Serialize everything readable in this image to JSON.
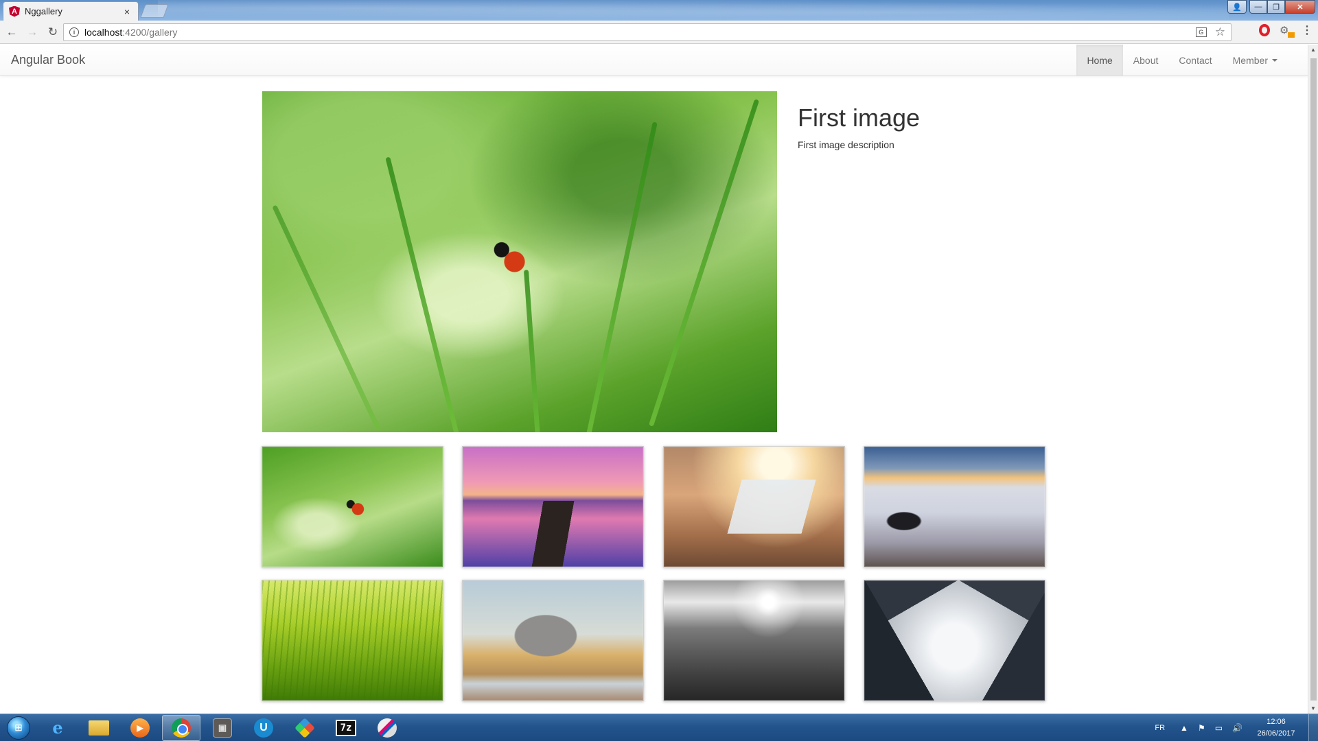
{
  "browser": {
    "tab_title": "Nggallery",
    "tab_close": "×",
    "favicon_letter": "A",
    "url_host": "localhost",
    "url_path": ":4200/gallery",
    "info_glyph": "i",
    "back_glyph": "←",
    "forward_glyph": "→",
    "reload_glyph": "↻",
    "star_glyph": "☆",
    "menu_glyph": "⋮",
    "translate_glyph": "G",
    "icons": [
      "angular-favicon-icon",
      "back-icon",
      "forward-icon",
      "reload-icon",
      "info-icon",
      "translate-icon",
      "star-icon",
      "opera-icon",
      "extension-icon",
      "menu-icon"
    ]
  },
  "window_controls": {
    "minimize": "—",
    "maximize": "❐",
    "close": "✕",
    "user": "👤"
  },
  "navbar": {
    "brand": "Angular Book",
    "links": [
      {
        "label": "Home",
        "active": true
      },
      {
        "label": "About",
        "active": false
      },
      {
        "label": "Contact",
        "active": false
      },
      {
        "label": "Member",
        "active": false,
        "dropdown": true
      }
    ]
  },
  "gallery": {
    "selected_title": "First image",
    "selected_description": "First image description",
    "thumbnails": [
      {
        "subject": "ladybug on grass"
      },
      {
        "subject": "wooden pier at sunset"
      },
      {
        "subject": "hand holding phone"
      },
      {
        "subject": "man above clouds"
      },
      {
        "subject": "green grass"
      },
      {
        "subject": "elephant"
      },
      {
        "subject": "black and white mountains"
      },
      {
        "subject": "skyscrapers from below"
      }
    ]
  },
  "taskbar": {
    "start_glyph": "⊞",
    "apps": [
      "internet-explorer-icon",
      "file-explorer-icon",
      "media-player-icon",
      "chrome-icon",
      "virtualbox-icon",
      "ultraedit-icon",
      "kite-icon",
      "7zip-icon",
      "paint-icon"
    ],
    "ie_glyph": "e",
    "media_glyph": "▶",
    "u_glyph": "U",
    "sevenzip_label": "7z",
    "box_glyph": "▣",
    "language": "FR",
    "tray_glyphs": {
      "up": "▲",
      "flag": "⚑",
      "network": "▭",
      "volume": "🔊"
    },
    "clock_time": "12:06",
    "clock_date": "26/06/2017"
  },
  "colors": {
    "navbar_active_bg": "#e7e7e7",
    "taskbar": "#23548c",
    "angular_red": "#c3002f"
  }
}
